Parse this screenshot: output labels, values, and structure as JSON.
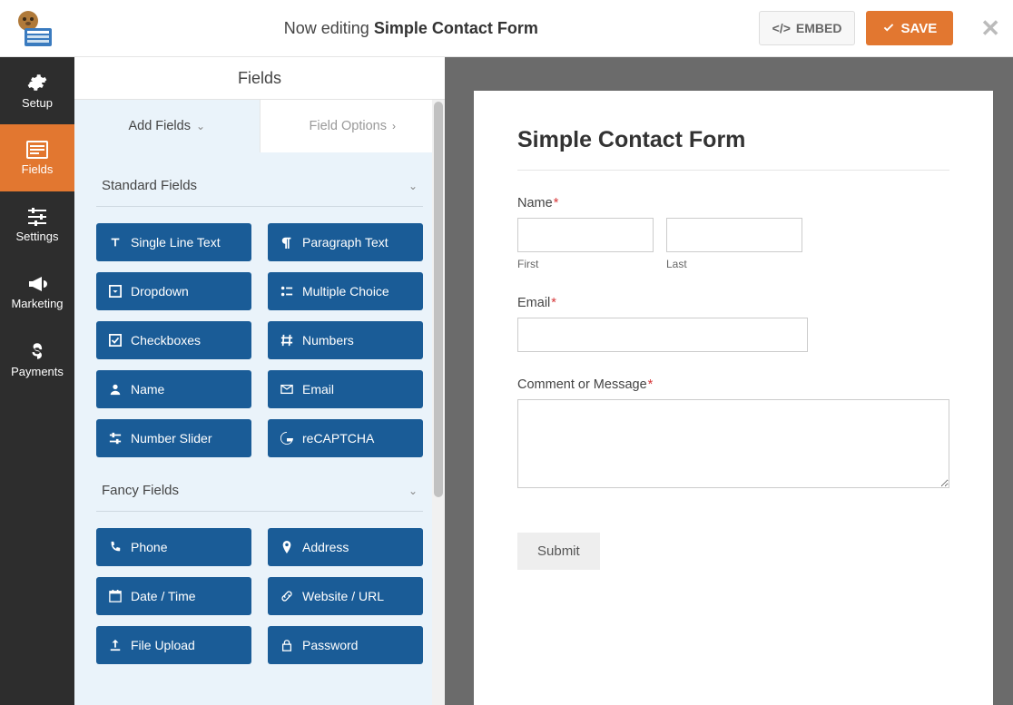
{
  "header": {
    "editing_prefix": "Now editing",
    "form_name": "Simple Contact Form",
    "embed_label": "EMBED",
    "save_label": "SAVE"
  },
  "nav": {
    "setup": "Setup",
    "fields": "Fields",
    "settings": "Settings",
    "marketing": "Marketing",
    "payments": "Payments"
  },
  "panel": {
    "title": "Fields",
    "tab_add": "Add Fields",
    "tab_options": "Field Options"
  },
  "groups": {
    "standard": "Standard Fields",
    "fancy": "Fancy Fields"
  },
  "standard_fields": {
    "single_line": "Single Line Text",
    "paragraph": "Paragraph Text",
    "dropdown": "Dropdown",
    "multiple_choice": "Multiple Choice",
    "checkboxes": "Checkboxes",
    "numbers": "Numbers",
    "name": "Name",
    "email": "Email",
    "number_slider": "Number Slider",
    "recaptcha": "reCAPTCHA"
  },
  "fancy_fields": {
    "phone": "Phone",
    "address": "Address",
    "date_time": "Date / Time",
    "website": "Website / URL",
    "file_upload": "File Upload",
    "password": "Password"
  },
  "form": {
    "title": "Simple Contact Form",
    "name_label": "Name",
    "first": "First",
    "last": "Last",
    "email_label": "Email",
    "comment_label": "Comment or Message",
    "submit": "Submit",
    "required": "*"
  }
}
